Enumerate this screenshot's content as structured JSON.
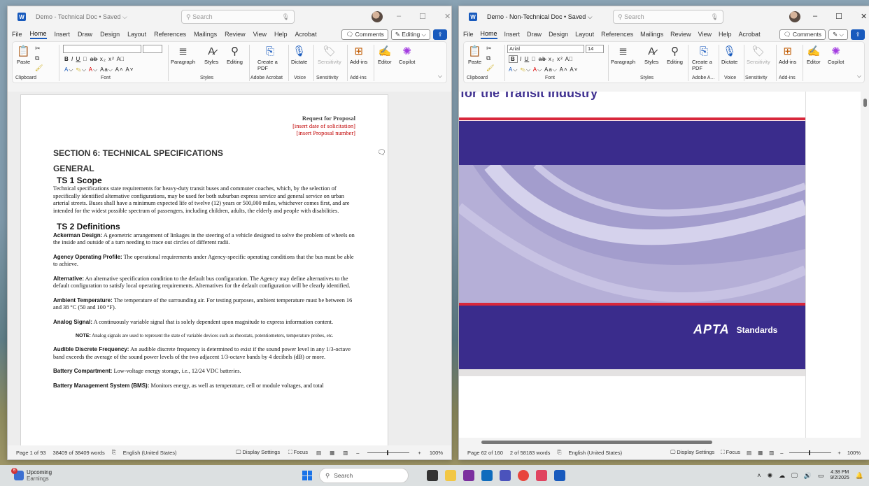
{
  "left_window": {
    "title": "Demo - Technical Doc • Saved ⌵",
    "search_placeholder": "Search",
    "tabs": [
      "File",
      "Home",
      "Insert",
      "Draw",
      "Design",
      "Layout",
      "References",
      "Mailings",
      "Review",
      "View",
      "Help",
      "Acrobat"
    ],
    "comments_label": "Comments",
    "editing_label": "Editing ⌵",
    "ribbon": {
      "font_name": "",
      "font_size": "",
      "groups": [
        "Clipboard",
        "Font",
        "Styles",
        "Adobe Acrobat",
        "Voice",
        "Sensitivity",
        "Add-ins"
      ],
      "buttons": {
        "paste": "Paste",
        "paragraph": "Paragraph",
        "styles": "Styles",
        "editing": "Editing",
        "create_pdf": "Create a PDF",
        "dictate": "Dictate",
        "sensitivity": "Sensitivity",
        "addins": "Add-ins",
        "editor": "Editor",
        "copilot": "Copilot"
      }
    },
    "document": {
      "rfp_title": "Request for Proposal",
      "rfp_date": "[insert date of solicitation]",
      "rfp_number": "[insert Proposal number]",
      "section_heading": "SECTION 6: TECHNICAL SPECIFICATIONS",
      "general_heading": "GENERAL",
      "ts1_heading": "TS 1 Scope",
      "ts1_body": "Technical specifications state requirements for heavy-duty transit buses and commuter coaches, which, by the selection of specifically identified alternative configurations, may be used for both suburban express service and general service on urban arterial streets. Buses shall have a minimum expected life of twelve (12) years or 500,000 miles, whichever comes first, and are intended for the widest possible spectrum of passengers, including children, adults, the elderly and people with disabilities.",
      "ts2_heading": "TS 2 Definitions",
      "definitions": [
        {
          "term": "Ackerman Design:",
          "text": " A geometric arrangement of linkages in the steering of a vehicle designed to solve the problem of wheels on the inside and outside of a turn needing to trace out circles of different radii."
        },
        {
          "term": "Agency Operating Profile:",
          "text": " The operational requirements under Agency-specific operating conditions that the bus must be able to achieve."
        },
        {
          "term": "Alternative:",
          "text": " An alternative specification condition to the default bus configuration. The Agency may define alternatives to the default configuration to satisfy local operating requirements. Alternatives for the default configuration will be clearly identified."
        },
        {
          "term": "Ambient Temperature:",
          "text": " The temperature of the surrounding air. For testing purposes, ambient temperature must be between 16 and 38 °C (50 and 100 °F)."
        },
        {
          "term": "Analog Signal:",
          "text": " A continuously variable signal that is solely dependent upon magnitude to express information content."
        }
      ],
      "note_label": "NOTE:",
      "note_text": " Analog signals are used to represent the state of variable devices such as rheostats, potentiometers, temperature probes, etc.",
      "definitions2": [
        {
          "term": "Audible Discrete Frequency:",
          "text": " An audible discrete frequency is determined to exist if the sound power level in any 1/3-octave band exceeds the average of the sound power levels of the two adjacent 1/3-octave bands by 4 decibels (dB) or more."
        },
        {
          "term": "Battery Compartment:",
          "text": " Low-voltage energy storage, i.e., 12/24 VDC batteries."
        },
        {
          "term": "Battery Management System (BMS):",
          "text": " Monitors energy, as well as temperature, cell or module voltages, and total"
        }
      ]
    },
    "status": {
      "page": "Page 1 of 93",
      "words": "38409 of 38409 words",
      "language": "English (United States)",
      "display_settings": "Display Settings",
      "focus": "Focus",
      "zoom": "100%"
    }
  },
  "right_window": {
    "title": "Demo - Non-Technical Doc • Saved ⌵",
    "search_placeholder": "Search",
    "tabs": [
      "File",
      "Home",
      "Insert",
      "Draw",
      "Design",
      "Layout",
      "References",
      "Mailings",
      "Review",
      "View",
      "Help",
      "Acrobat"
    ],
    "comments_label": "Comments",
    "ribbon": {
      "font_name": "Arial",
      "font_size": "14",
      "groups": [
        "Clipboard",
        "Font",
        "Styles",
        "Adobe A...",
        "Voice",
        "Sensitivity",
        "Add-ins"
      ],
      "buttons": {
        "paste": "Paste",
        "paragraph": "Paragraph",
        "styles": "Styles",
        "editing": "Editing",
        "create_pdf": "Create a PDF",
        "dictate": "Dictate",
        "sensitivity": "Sensitivity",
        "addins": "Add-ins",
        "editor": "Editor",
        "copilot": "Copilot"
      }
    },
    "document": {
      "cover_title": "for the Transit Industry",
      "logo_text": "APTA",
      "standards_text": "Standards"
    },
    "status": {
      "page": "Page 62 of 160",
      "words": "2 of 58183 words",
      "language": "English (United States)",
      "display_settings": "Display Settings",
      "focus": "Focus",
      "zoom": "100%"
    }
  },
  "taskbar": {
    "weather_title": "Upcoming",
    "weather_sub": "Earnings",
    "search_placeholder": "Search",
    "time": "4:38 PM",
    "date": "9/2/2025"
  },
  "colors": {
    "word_blue": "#185abd",
    "apta_purple": "#3a2c8c",
    "apta_red": "#d8273b",
    "rfp_red": "#c00000"
  }
}
